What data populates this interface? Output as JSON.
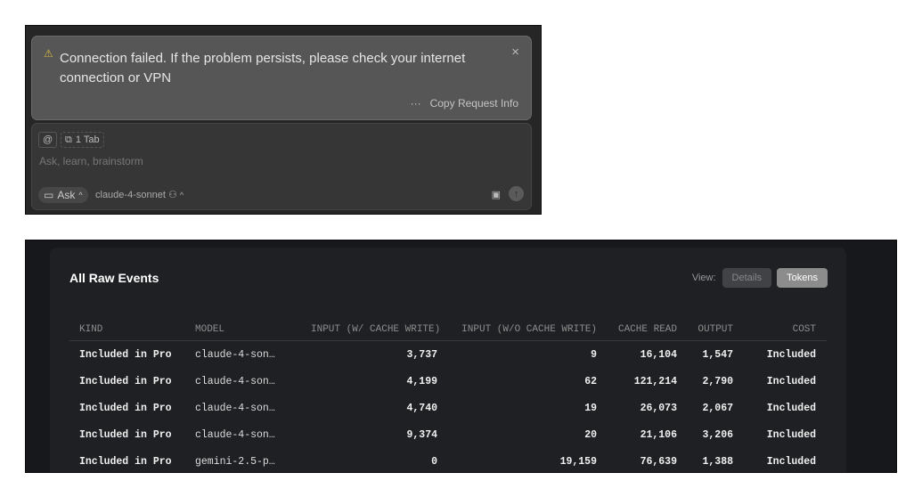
{
  "chat": {
    "error": {
      "message": "Connection failed. If the problem persists, please check your internet connection or VPN",
      "copy_label": "Copy Request Info",
      "more_icon": "···",
      "close_icon": "×"
    },
    "input": {
      "mention_icon": "@",
      "tab_chip": "1 Tab",
      "placeholder": "Ask, learn, brainstorm",
      "mode": "Ask",
      "model": "claude-4-sonnet"
    }
  },
  "events": {
    "title": "All Raw Events",
    "view_label": "View:",
    "view_options": [
      "Details",
      "Tokens"
    ],
    "selected_view": "Tokens",
    "columns": [
      "KIND",
      "MODEL",
      "INPUT (W/ CACHE WRITE)",
      "INPUT (W/O CACHE WRITE)",
      "CACHE READ",
      "OUTPUT",
      "COST"
    ],
    "rows": [
      [
        "Included in Pro",
        "claude-4-son…",
        "3,737",
        "9",
        "16,104",
        "1,547",
        "Included"
      ],
      [
        "Included in Pro",
        "claude-4-son…",
        "4,199",
        "62",
        "121,214",
        "2,790",
        "Included"
      ],
      [
        "Included in Pro",
        "claude-4-son…",
        "4,740",
        "19",
        "26,073",
        "2,067",
        "Included"
      ],
      [
        "Included in Pro",
        "claude-4-son…",
        "9,374",
        "20",
        "21,106",
        "3,206",
        "Included"
      ],
      [
        "Included in Pro",
        "gemini-2.5-p…",
        "0",
        "19,159",
        "76,639",
        "1,388",
        "Included"
      ]
    ]
  }
}
